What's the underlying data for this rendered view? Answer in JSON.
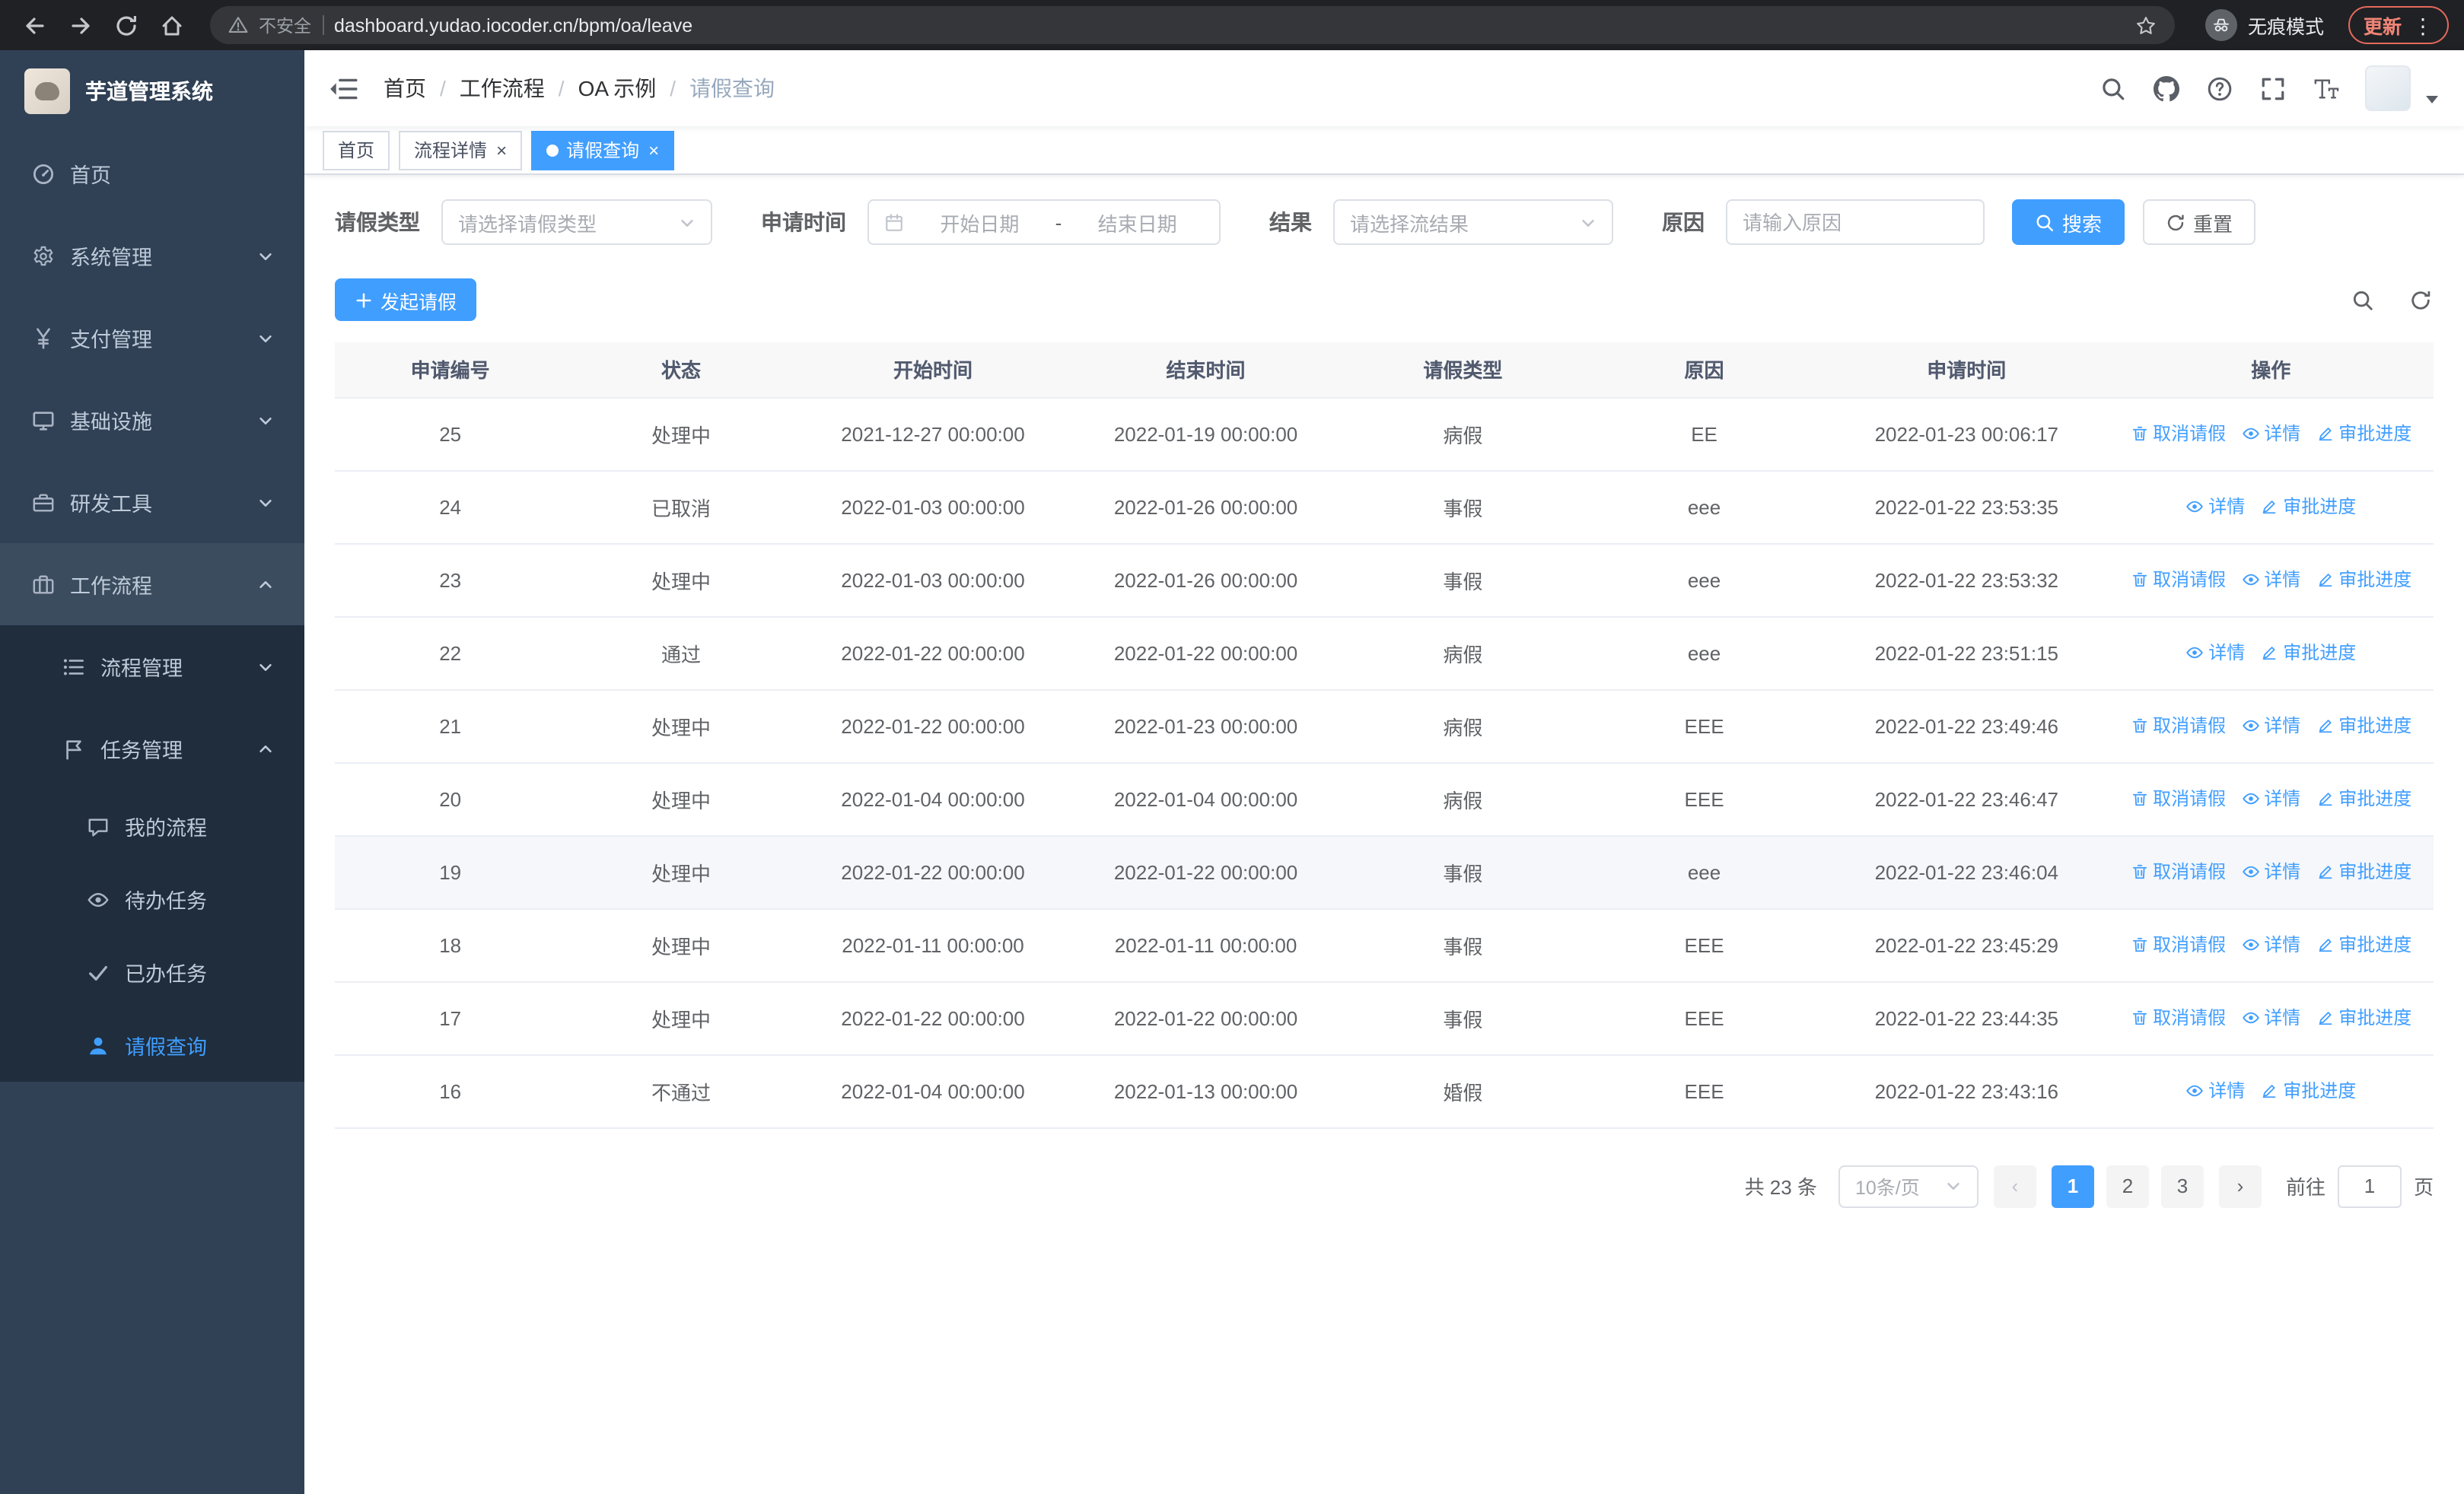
{
  "colors": {
    "accent": "#409eff",
    "sidebar_bg": "#304156",
    "sidebar_submenu_bg": "#1f2d3d",
    "sidebar_text": "#bfcbd9",
    "browser_bar_bg": "#202124",
    "update_red": "#f08577",
    "table_header_bg": "#f8f8f9"
  },
  "browser": {
    "security_warning": "不安全",
    "url": "dashboard.yudao.iocoder.cn/bpm/oa/leave",
    "incognito_label": "无痕模式",
    "update_label": "更新"
  },
  "sidebar": {
    "logo_title": "芋道管理系统",
    "items": [
      {
        "key": "home",
        "label": "首页",
        "icon": "dashboard-icon"
      },
      {
        "key": "system",
        "label": "系统管理",
        "icon": "gear-icon",
        "chevron": "down"
      },
      {
        "key": "payment",
        "label": "支付管理",
        "icon": "yen-icon",
        "chevron": "down"
      },
      {
        "key": "infrastructure",
        "label": "基础设施",
        "icon": "monitor-icon",
        "chevron": "down"
      },
      {
        "key": "dev-tools",
        "label": "研发工具",
        "icon": "toolbox-icon",
        "chevron": "down"
      },
      {
        "key": "workflow",
        "label": "工作流程",
        "icon": "suitcase-icon",
        "chevron": "up",
        "children": [
          {
            "key": "process-management",
            "label": "流程管理",
            "icon": "flow-list-icon",
            "chevron": "down"
          },
          {
            "key": "task-management",
            "label": "任务管理",
            "icon": "task-icon",
            "chevron": "up",
            "children": [
              {
                "key": "my-process",
                "label": "我的流程",
                "icon": "chat-icon"
              },
              {
                "key": "todo-tasks",
                "label": "待办任务",
                "icon": "eye-icon"
              },
              {
                "key": "done-tasks",
                "label": "已办任务",
                "icon": "check-icon"
              },
              {
                "key": "leave-query",
                "label": "请假查询",
                "icon": "user-icon",
                "active": true
              }
            ]
          }
        ]
      }
    ]
  },
  "header": {
    "breadcrumb": [
      "首页",
      "工作流程",
      "OA 示例",
      "请假查询"
    ]
  },
  "tabs": [
    {
      "key": "home",
      "label": "首页"
    },
    {
      "key": "process-detail",
      "label": "流程详情",
      "closable": true
    },
    {
      "key": "leave-query",
      "label": "请假查询",
      "closable": true,
      "active": true
    }
  ],
  "filters": {
    "leave_type_label": "请假类型",
    "leave_type_placeholder": "请选择请假类型",
    "apply_time_label": "申请时间",
    "date_start_placeholder": "开始日期",
    "date_separator": "-",
    "date_end_placeholder": "结束日期",
    "result_label": "结果",
    "result_placeholder": "请选择流结果",
    "reason_label": "原因",
    "reason_placeholder": "请输入原因",
    "search_label": "搜索",
    "reset_label": "重置"
  },
  "toolbar": {
    "create_label": "发起请假"
  },
  "table": {
    "columns": [
      "申请编号",
      "状态",
      "开始时间",
      "结束时间",
      "请假类型",
      "原因",
      "申请时间",
      "操作"
    ],
    "action_labels": {
      "cancel": "取消请假",
      "detail": "详情",
      "progress": "审批进度"
    },
    "rows": [
      {
        "no": "25",
        "status": "处理中",
        "start": "2021-12-27 00:00:00",
        "end": "2022-01-19 00:00:00",
        "type": "病假",
        "reason": "EE",
        "applied": "2022-01-23 00:06:17",
        "can_cancel": true
      },
      {
        "no": "24",
        "status": "已取消",
        "start": "2022-01-03 00:00:00",
        "end": "2022-01-26 00:00:00",
        "type": "事假",
        "reason": "eee",
        "applied": "2022-01-22 23:53:35",
        "can_cancel": false
      },
      {
        "no": "23",
        "status": "处理中",
        "start": "2022-01-03 00:00:00",
        "end": "2022-01-26 00:00:00",
        "type": "事假",
        "reason": "eee",
        "applied": "2022-01-22 23:53:32",
        "can_cancel": true
      },
      {
        "no": "22",
        "status": "通过",
        "start": "2022-01-22 00:00:00",
        "end": "2022-01-22 00:00:00",
        "type": "病假",
        "reason": "eee",
        "applied": "2022-01-22 23:51:15",
        "can_cancel": false
      },
      {
        "no": "21",
        "status": "处理中",
        "start": "2022-01-22 00:00:00",
        "end": "2022-01-23 00:00:00",
        "type": "病假",
        "reason": "EEE",
        "applied": "2022-01-22 23:49:46",
        "can_cancel": true
      },
      {
        "no": "20",
        "status": "处理中",
        "start": "2022-01-04 00:00:00",
        "end": "2022-01-04 00:00:00",
        "type": "病假",
        "reason": "EEE",
        "applied": "2022-01-22 23:46:47",
        "can_cancel": true
      },
      {
        "no": "19",
        "status": "处理中",
        "start": "2022-01-22 00:00:00",
        "end": "2022-01-22 00:00:00",
        "type": "事假",
        "reason": "eee",
        "applied": "2022-01-22 23:46:04",
        "can_cancel": true,
        "hovered": true
      },
      {
        "no": "18",
        "status": "处理中",
        "start": "2022-01-11 00:00:00",
        "end": "2022-01-11 00:00:00",
        "type": "事假",
        "reason": "EEE",
        "applied": "2022-01-22 23:45:29",
        "can_cancel": true
      },
      {
        "no": "17",
        "status": "处理中",
        "start": "2022-01-22 00:00:00",
        "end": "2022-01-22 00:00:00",
        "type": "事假",
        "reason": "EEE",
        "applied": "2022-01-22 23:44:35",
        "can_cancel": true
      },
      {
        "no": "16",
        "status": "不通过",
        "start": "2022-01-04 00:00:00",
        "end": "2022-01-13 00:00:00",
        "type": "婚假",
        "reason": "EEE",
        "applied": "2022-01-22 23:43:16",
        "can_cancel": false
      }
    ]
  },
  "pagination": {
    "total_label": "共 23 条",
    "page_size_label": "10条/页",
    "pages": [
      "1",
      "2",
      "3"
    ],
    "current_page": "1",
    "goto_label": "前往",
    "goto_value": "1",
    "goto_suffix": "页"
  }
}
